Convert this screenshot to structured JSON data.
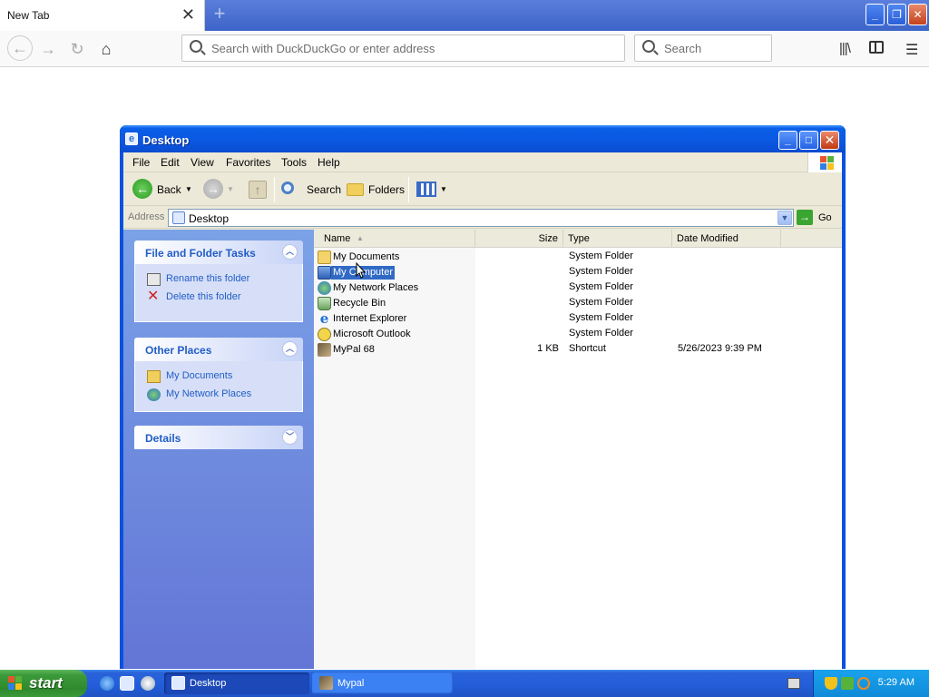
{
  "browser": {
    "tab_title": "New Tab",
    "tab_close": "✕",
    "new_tab": "+",
    "url_placeholder": "Search with DuckDuckGo or enter address",
    "search_placeholder": "Search",
    "min": "_",
    "max": "❐",
    "close": "✕"
  },
  "explorer": {
    "title": "Desktop",
    "menu": [
      "File",
      "Edit",
      "View",
      "Favorites",
      "Tools",
      "Help"
    ],
    "toolbar": {
      "back": "Back",
      "search": "Search",
      "folders": "Folders"
    },
    "address_label": "Address",
    "address_value": "Desktop",
    "go": "Go",
    "tasks": {
      "file_folder_title": "File and Folder Tasks",
      "rename": "Rename this folder",
      "delete": "Delete this folder",
      "other_places_title": "Other Places",
      "my_documents": "My Documents",
      "my_network_places": "My Network Places",
      "details_title": "Details"
    },
    "columns": [
      "Name",
      "Size",
      "Type",
      "Date Modified"
    ],
    "files": [
      {
        "name": "My Documents",
        "size": "",
        "type": "System Folder",
        "date": ""
      },
      {
        "name": "My Computer",
        "size": "",
        "type": "System Folder",
        "date": ""
      },
      {
        "name": "My Network Places",
        "size": "",
        "type": "System Folder",
        "date": ""
      },
      {
        "name": "Recycle Bin",
        "size": "",
        "type": "System Folder",
        "date": ""
      },
      {
        "name": "Internet Explorer",
        "size": "",
        "type": "System Folder",
        "date": ""
      },
      {
        "name": "Microsoft Outlook",
        "size": "",
        "type": "System Folder",
        "date": ""
      },
      {
        "name": "MyPal 68",
        "size": "1 KB",
        "type": "Shortcut",
        "date": "5/26/2023 9:39 PM"
      }
    ]
  },
  "taskbar": {
    "start": "start",
    "tasks": [
      "Desktop",
      "Mypal"
    ],
    "clock": "5:29 AM"
  },
  "colors": {
    "xp_blue": "#0a51e0",
    "selection": "#316ac5",
    "start_green": "#3c9a3a",
    "task_link": "#215dc6"
  }
}
